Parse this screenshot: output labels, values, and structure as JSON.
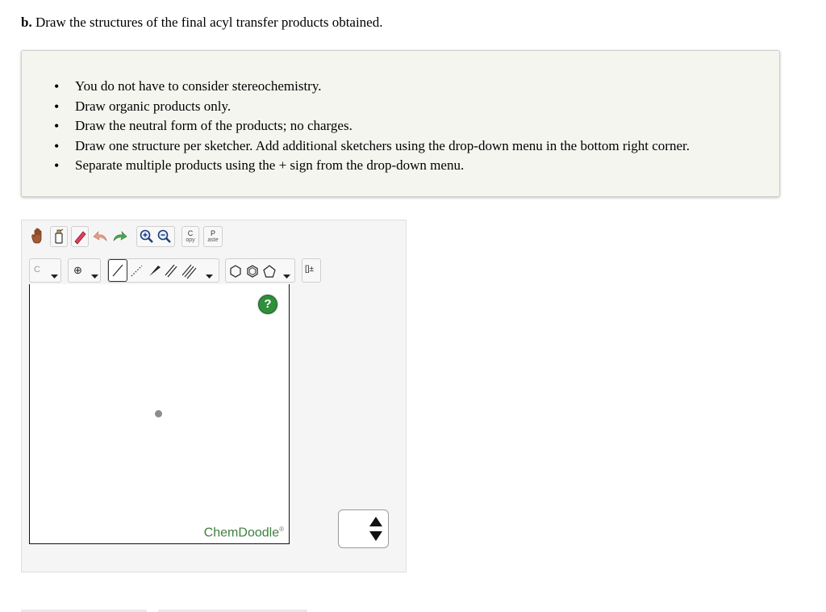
{
  "question": {
    "label": "b.",
    "text": "Draw the structures of the final acyl transfer products obtained."
  },
  "instructions": [
    "You do not have to consider stereochemistry.",
    "Draw organic products only.",
    "Draw the neutral form of the products; no charges.",
    "Draw one structure per sketcher. Add additional sketchers using the drop-down menu in the bottom right corner.",
    "Separate multiple products using the + sign from the drop-down menu."
  ],
  "toolbar": {
    "copy_label_top": "C",
    "copy_label_bottom": "opy",
    "paste_label_top": "P",
    "paste_label_bottom": "aste",
    "element_label": "C",
    "charge_label": "⊕",
    "bracket_label": "[]±"
  },
  "sketcher": {
    "help_label": "?",
    "brand": "ChemDoodle",
    "brand_mark": "®"
  },
  "colors": {
    "brand_green": "#3f7f3f",
    "help_green": "#2f8f3a",
    "panel_bg": "#f5f5f0"
  }
}
